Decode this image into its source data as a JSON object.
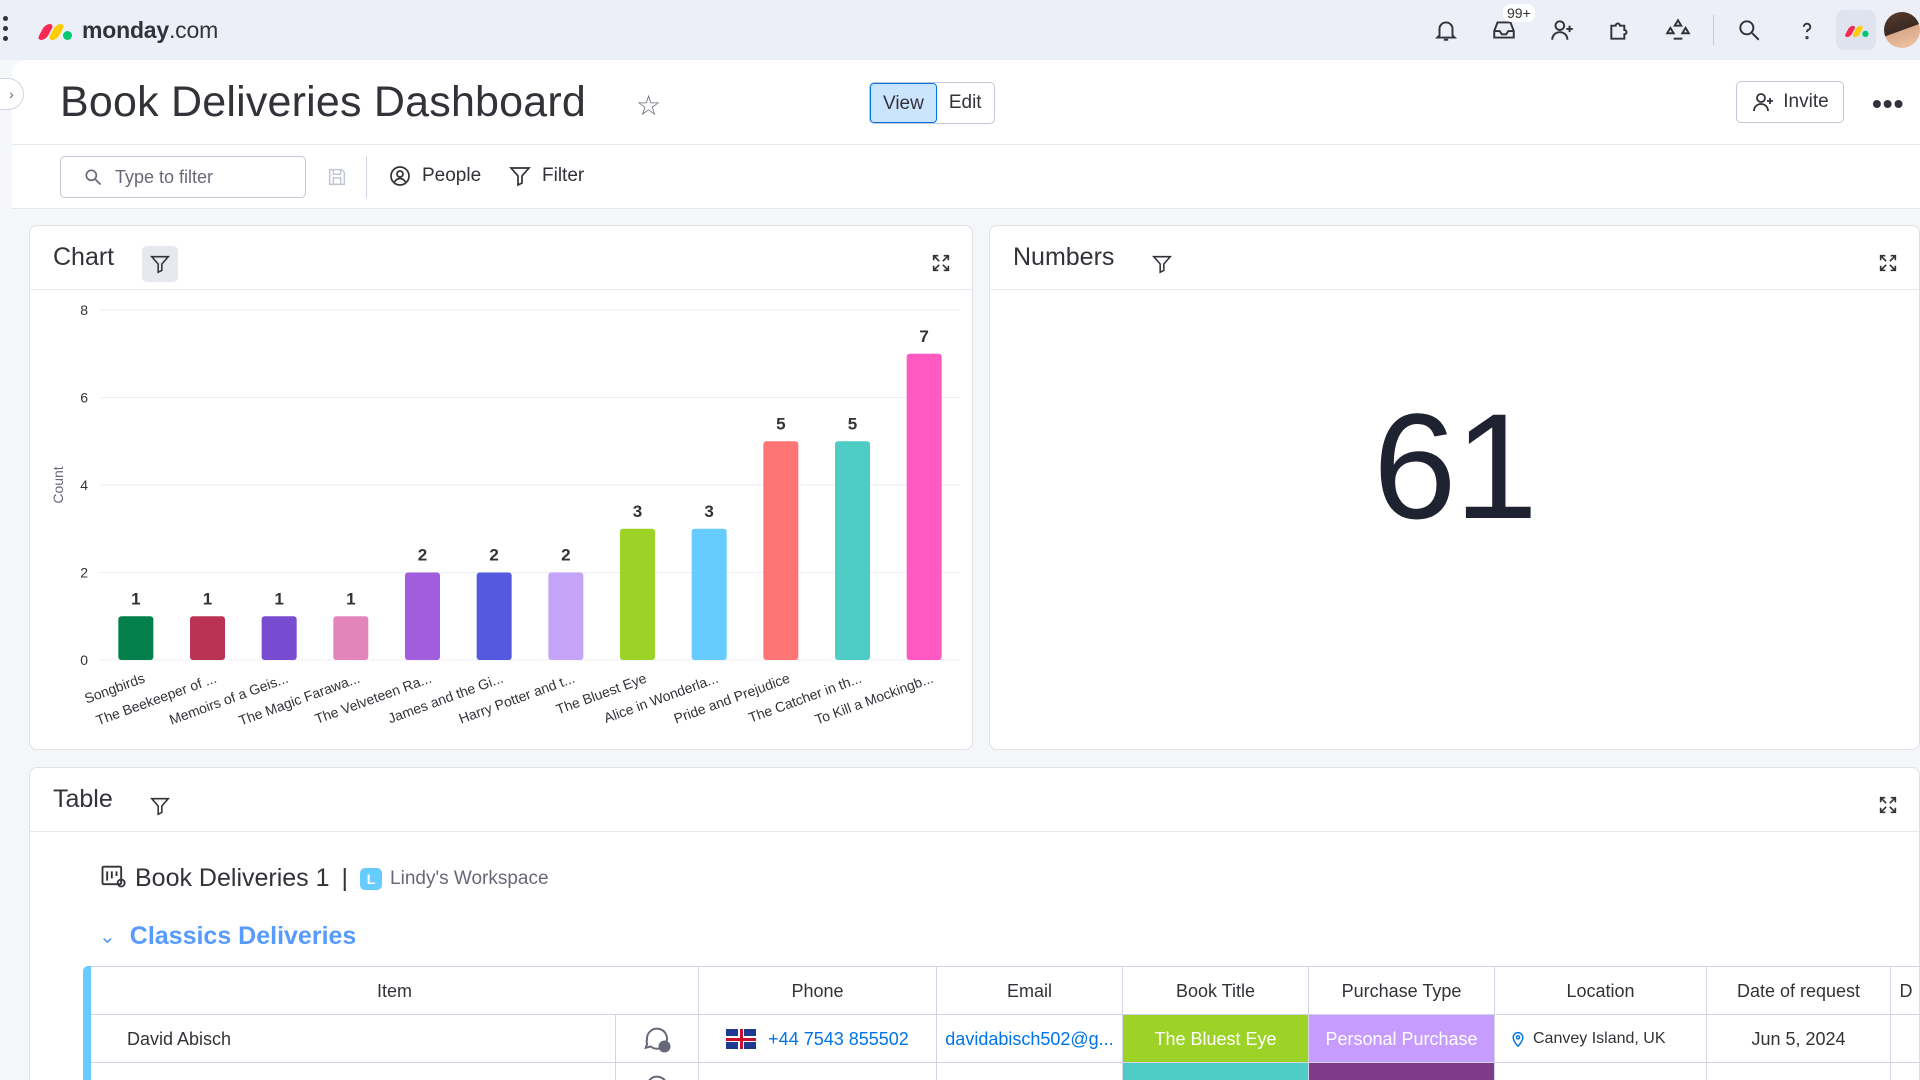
{
  "app": {
    "logo_text_bold": "monday",
    "logo_text_rest": ".com",
    "inbox_badge": "99+"
  },
  "header": {
    "title": "Book Deliveries Dashboard",
    "view_label": "View",
    "edit_label": "Edit",
    "invite_label": "Invite"
  },
  "filter_bar": {
    "search_placeholder": "Type to filter",
    "people_label": "People",
    "filter_label": "Filter"
  },
  "chart_widget": {
    "title": "Chart"
  },
  "numbers_widget": {
    "title": "Numbers",
    "value": "61"
  },
  "table_widget": {
    "title": "Table",
    "board_name": "Book Deliveries 1",
    "separator": "|",
    "workspace_initial": "L",
    "workspace_name": "Lindy's Workspace",
    "group_name": "Classics Deliveries",
    "columns": [
      "Item",
      "Phone",
      "Email",
      "Book Title",
      "Purchase Type",
      "Location",
      "Date of request",
      "D"
    ],
    "rows": [
      {
        "item": "David Abisch",
        "phone": "+44 7543 855502",
        "email": "davidabisch502@g...",
        "book_title": "The Bluest Eye",
        "purchase_type": "Personal Purchase",
        "location": "Canvey Island, UK",
        "date": "Jun 5, 2024"
      }
    ]
  },
  "chart_data": {
    "type": "bar",
    "ylabel": "Count",
    "ylim": [
      0,
      8
    ],
    "yticks": [
      0,
      2,
      4,
      6,
      8
    ],
    "grid": true,
    "categories": [
      "Songbirds",
      "The Beekeeper of ...",
      "Memoirs of a Geis...",
      "The Magic Farawa...",
      "The Velveteen Ra...",
      "James and the Gi...",
      "Harry Potter and t...",
      "The Bluest Eye",
      "Alice in Wonderla...",
      "Pride and Prejudice",
      "The Catcher in th...",
      "To Kill a Mockingb..."
    ],
    "values": [
      1,
      1,
      1,
      1,
      2,
      2,
      2,
      3,
      3,
      5,
      5,
      7
    ],
    "colors": [
      "#037f4c",
      "#bb3354",
      "#784bd1",
      "#e484bd",
      "#a25ddc",
      "#5559df",
      "#c4a4f7",
      "#9cd326",
      "#66ccff",
      "#ff7575",
      "#4eccc6",
      "#ff5ac4"
    ]
  }
}
